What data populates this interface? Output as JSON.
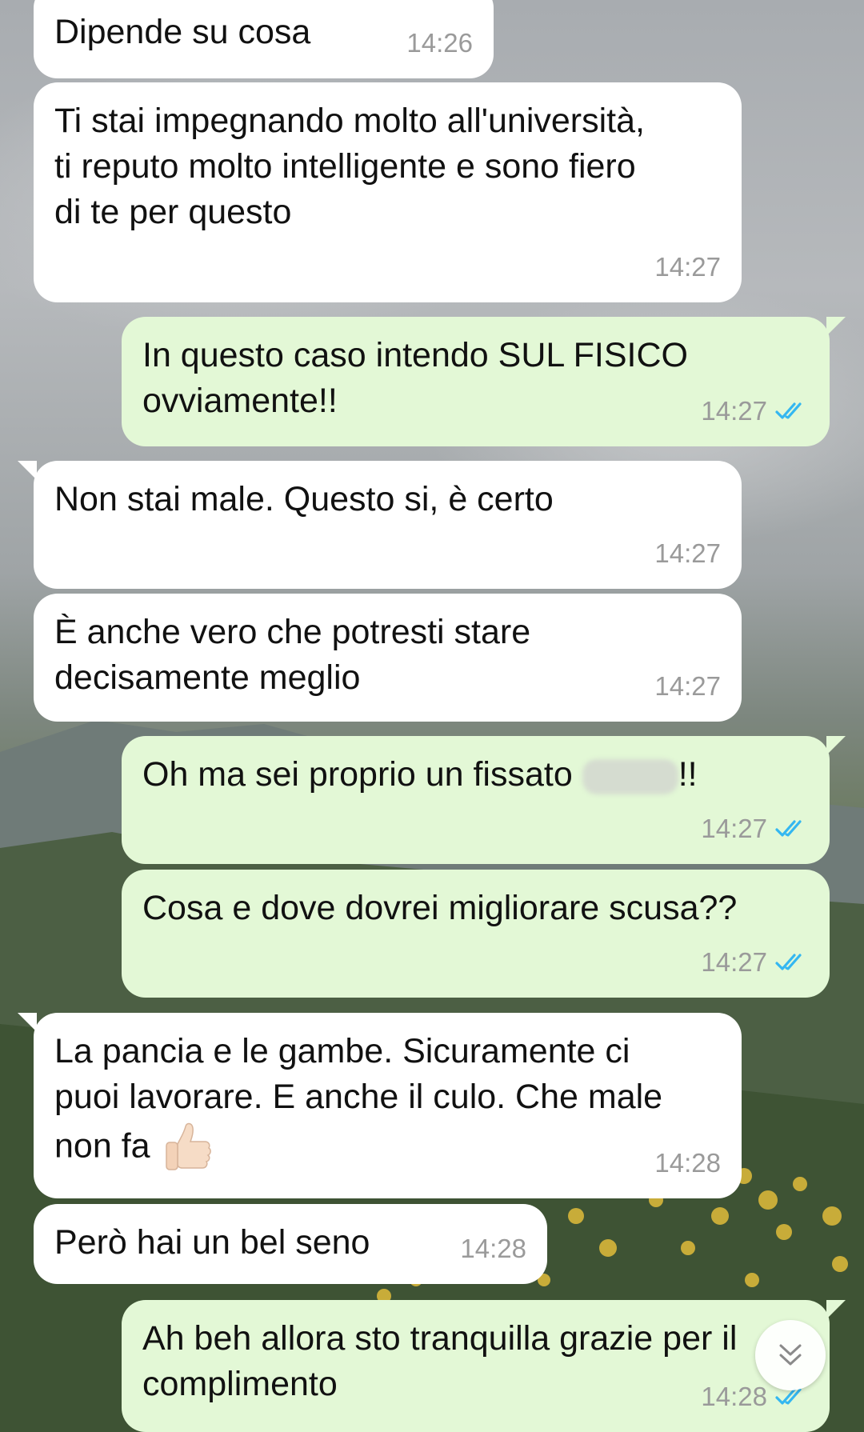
{
  "chat": {
    "messages": [
      {
        "direction": "incoming",
        "text": "Dipende su cosa",
        "time": "14:26"
      },
      {
        "direction": "incoming",
        "text": "Ti stai impegnando molto all'università, ti reputo molto intelligente e sono fiero di te per questo",
        "time": "14:27"
      },
      {
        "direction": "outgoing",
        "text": "In questo caso intendo SUL FISICO ovviamente!!",
        "time": "14:27",
        "status": "read"
      },
      {
        "direction": "incoming",
        "text": "Non stai male. Questo si, è certo",
        "time": "14:27"
      },
      {
        "direction": "incoming",
        "text": "È anche vero che potresti stare decisamente meglio",
        "time": "14:27"
      },
      {
        "direction": "outgoing",
        "text_before": "Oh ma sei proprio un fissato",
        "redacted": true,
        "text_after": "!!",
        "time": "14:27",
        "status": "read"
      },
      {
        "direction": "outgoing",
        "text": "Cosa e dove dovrei migliorare scusa??",
        "time": "14:27",
        "status": "read"
      },
      {
        "direction": "incoming",
        "text": "La pancia e le gambe. Sicuramente ci puoi lavorare. E anche il culo. Che male non fa",
        "emoji": "thumbs-up",
        "time": "14:28"
      },
      {
        "direction": "incoming",
        "text": "Però hai un bel seno",
        "time": "14:28"
      },
      {
        "direction": "outgoing",
        "text": "Ah beh allora sto tranquilla grazie per il complimento",
        "time": "14:28",
        "status": "read"
      }
    ]
  },
  "colors": {
    "incoming_bubble": "#ffffff",
    "outgoing_bubble": "#e3f8d6",
    "read_ticks": "#34b7f1",
    "timestamp": "#9a9a9a"
  },
  "icons": {
    "read_status": "double-check-icon",
    "scroll_down": "double-chevron-down-icon",
    "emoji": "thumbs-up-icon"
  }
}
